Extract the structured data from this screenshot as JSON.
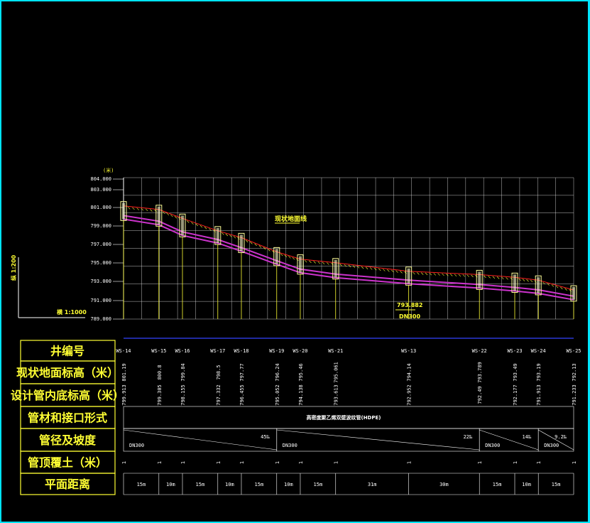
{
  "colors": {
    "grid": "#ffffff",
    "yellow": "#ffff33",
    "pipe": "#cc33cc",
    "ground": "#ff2020",
    "border": "#00e5ff",
    "blue": "#3344ff"
  },
  "y_unit": "(米)",
  "scale_v": "纵 1:200",
  "scale_h": "横 1:1000",
  "ground_label": "现状地面线",
  "callout": {
    "value": "793.882",
    "pipe": "DN300"
  },
  "row_labels": {
    "well": "井编号",
    "ground": "现状地面标高（米）",
    "invert": "设计管内底标高（米）",
    "material": "管材和接口形式",
    "diam": "管径及坡度",
    "cover": "管顶覆土（米）",
    "dist": "平面距离"
  },
  "material_text": "高密度聚乙烯双壁波纹管(HDPE)",
  "chart_data": {
    "type": "profile",
    "y_ticks": [
      "804.000",
      "803.000",
      "801.000",
      "799.000",
      "797.000",
      "795.000",
      "793.000",
      "791.000",
      "789.000"
    ],
    "wells": [
      "WS-14",
      "WS-15",
      "WS-16",
      "WS-17",
      "WS-18",
      "WS-19",
      "WS-20",
      "WS-21",
      "WS-13",
      "WS-22",
      "WS-23",
      "WS-24",
      "WS-25"
    ],
    "ground_elev": [
      "801.19",
      "800.8",
      "799.84",
      "798.5",
      "797.77",
      "796.24",
      "795.46",
      "795.061",
      "794.14",
      "793.789",
      "793.49",
      "793.19",
      "792.13"
    ],
    "invert_elev": [
      "799.913",
      "799.305",
      "798.155",
      "797.332",
      "796.455",
      "795.052",
      "794.138",
      "793.613",
      "792.952",
      "792.49",
      "792.177",
      "791.913",
      "791.233"
    ],
    "cover": [
      "1",
      "1",
      "1",
      "1",
      "1",
      "1",
      "1",
      "1",
      "1",
      "1",
      "1",
      "1",
      "1"
    ],
    "distances": [
      "15m",
      "10m",
      "15m",
      "10m",
      "15m",
      "10m",
      "15m",
      "31m",
      "30m",
      "15m",
      "10m",
      "15m"
    ],
    "segments": [
      {
        "pipe": "DN300",
        "slope": "45‰"
      },
      {
        "pipe": "DN300",
        "slope": "22‰"
      },
      {
        "pipe": "DN300",
        "slope": "14‰"
      },
      {
        "pipe": "DN300",
        "slope": "9.2‰"
      }
    ]
  }
}
